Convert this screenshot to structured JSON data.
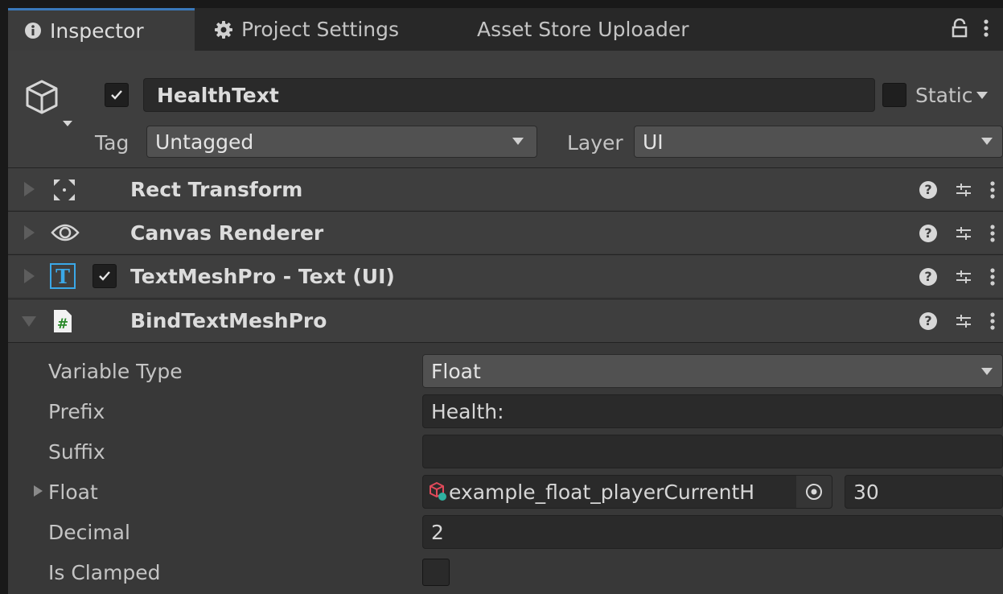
{
  "tabs": [
    {
      "label": "Inspector",
      "icon": "info-icon",
      "active": true
    },
    {
      "label": "Project Settings",
      "icon": "gear-icon",
      "active": false
    },
    {
      "label": "Asset Store Uploader",
      "icon": "",
      "active": false
    }
  ],
  "header": {
    "object_name": "HealthText",
    "active": true,
    "static_label": "Static",
    "tag_label": "Tag",
    "tag_value": "Untagged",
    "layer_label": "Layer",
    "layer_value": "UI"
  },
  "components": [
    {
      "title": "Rect Transform",
      "icon": "rect-transform-icon",
      "expanded": false
    },
    {
      "title": "Canvas Renderer",
      "icon": "eye-icon",
      "expanded": false
    },
    {
      "title": "TextMeshPro - Text (UI)",
      "icon": "textmeshpro-icon",
      "expanded": false,
      "enabled": true
    },
    {
      "title": "BindTextMeshPro",
      "icon": "script-icon",
      "expanded": true
    }
  ],
  "properties": {
    "variable_type_label": "Variable Type",
    "variable_type_value": "Float",
    "prefix_label": "Prefix",
    "prefix_value": "Health:",
    "suffix_label": "Suffix",
    "suffix_value": "",
    "float_label": "Float",
    "float_reference": "example_float_playerCurrentH",
    "float_value": "30",
    "decimal_label": "Decimal",
    "decimal_value": "2",
    "is_clamped_label": "Is Clamped",
    "is_clamped": false
  },
  "colors": {
    "accent": "#3a79bb",
    "panel": "#383838",
    "header": "#3e3e3e",
    "field": "#2a2a2a",
    "dropdown": "#515151"
  }
}
